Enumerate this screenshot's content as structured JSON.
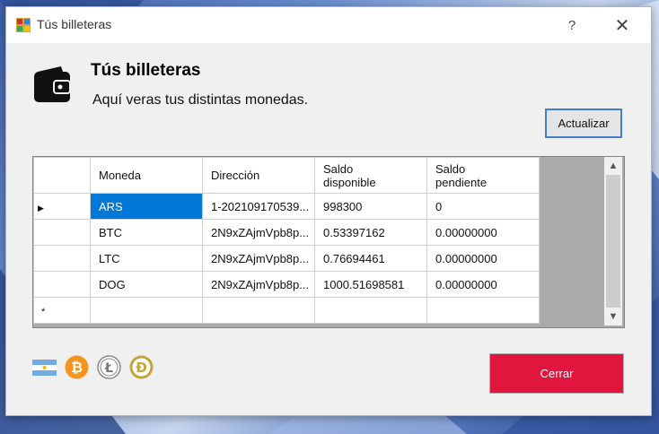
{
  "window": {
    "title": "Tús billeteras"
  },
  "titlebar": {
    "help_label": "?",
    "close_label": "✕"
  },
  "header": {
    "heading": "Tús billeteras",
    "subheading": "Aquí veras tus distintas monedas."
  },
  "actions": {
    "refresh_label": "Actualizar",
    "close_label": "Cerrar"
  },
  "table": {
    "columns": [
      "Moneda",
      "Dirección",
      "Saldo disponible",
      "Saldo pendiente"
    ],
    "rows": [
      [
        "ARS",
        "1-202109170539...",
        "998300",
        "0"
      ],
      [
        "BTC",
        "2N9xZAjmVpb8p...",
        "0.53397162",
        "0.00000000"
      ],
      [
        "LTC",
        "2N9xZAjmVpb8p...",
        "0.76694461",
        "0.00000000"
      ],
      [
        "DOG",
        "2N9xZAjmVpb8p...",
        "1000.51698581",
        "0.00000000"
      ]
    ],
    "current_row_marker": "▶",
    "new_row_marker": "*"
  },
  "currency_icons": [
    "argentina-flag-icon",
    "bitcoin-icon",
    "litecoin-icon",
    "dogecoin-icon"
  ],
  "colors": {
    "close_button": "#e0163e",
    "selection": "#0078d7",
    "refresh_border": "#3f7fd0"
  }
}
